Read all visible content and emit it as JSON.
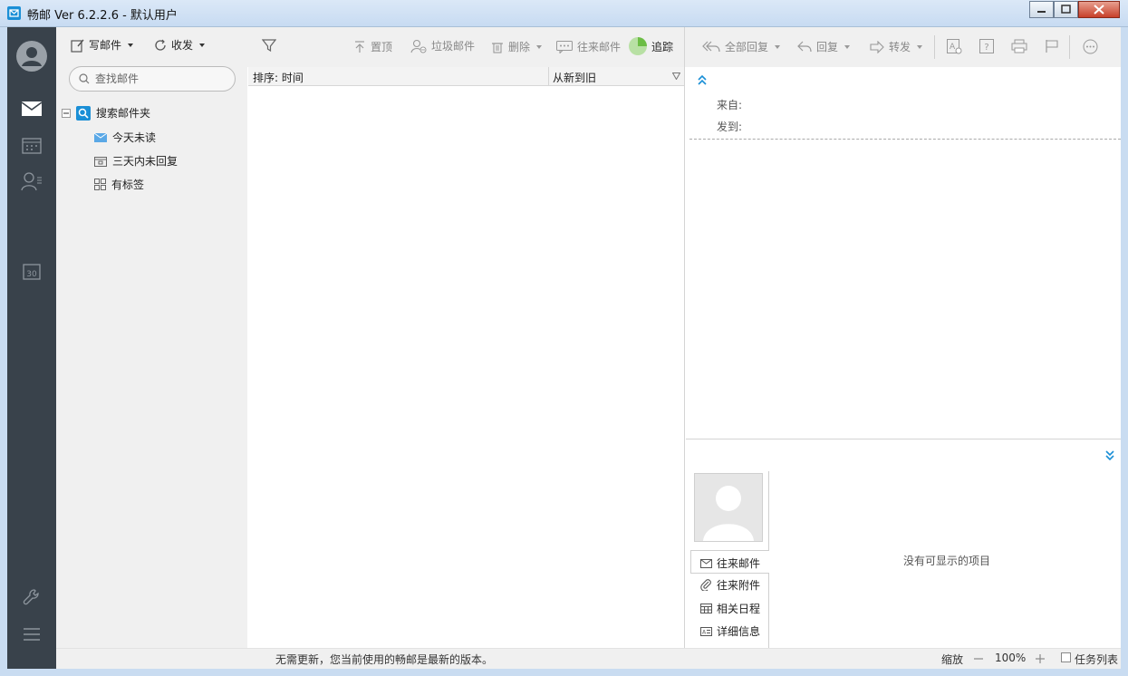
{
  "window": {
    "title": "畅邮 Ver 6.2.2.6  -  默认用户"
  },
  "colors": {
    "rail": "#39424b",
    "accent": "#1a8fd6",
    "pane": "#f0f0f0"
  },
  "toolbar": {
    "compose_label": "写邮件",
    "sendrecv_label": "收发",
    "pin_label": "置顶",
    "spam_label": "垃圾邮件",
    "delete_label": "删除",
    "conversation_label": "往来邮件",
    "track_label": "追踪"
  },
  "search": {
    "placeholder": "查找邮件"
  },
  "folder_tree": {
    "root_label": "搜索邮件夹",
    "items": [
      {
        "label": "今天未读",
        "icon": "envelope-icon"
      },
      {
        "label": "三天内未回复",
        "icon": "calendar-folder-icon"
      },
      {
        "label": "有标签",
        "icon": "tag-grid-icon"
      }
    ]
  },
  "list": {
    "sort_label": "排序: 时间",
    "order_label": "从新到旧"
  },
  "reading": {
    "reply_all_label": "全部回复",
    "reply_label": "回复",
    "forward_label": "转发",
    "from_label": "来自:",
    "to_label": "发到:",
    "empty_text": "没有可显示的项目",
    "tabs": [
      {
        "label": "往来邮件",
        "icon": "envelope-icon"
      },
      {
        "label": "往来附件",
        "icon": "paperclip-icon"
      },
      {
        "label": "相关日程",
        "icon": "calendar-icon"
      },
      {
        "label": "详细信息",
        "icon": "id-card-icon"
      }
    ]
  },
  "status": {
    "message": "无需更新，您当前使用的畅邮是最新的版本。",
    "zoom_label": "缩放",
    "zoom_value": "100%",
    "tasklist_label": "任务列表"
  }
}
